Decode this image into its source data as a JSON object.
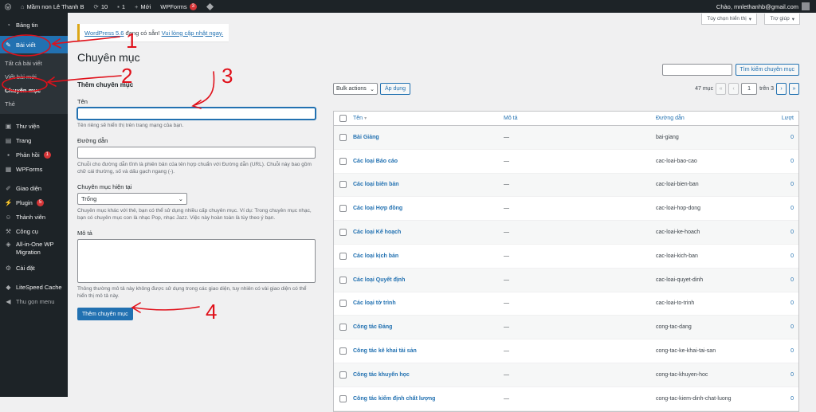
{
  "adminbar": {
    "site_name": "Mầm non Lê Thanh B",
    "updates_count": "10",
    "comments_count": "1",
    "new_label": "Mới",
    "wpforms_label": "WPForms",
    "wpforms_badge": "3",
    "greeting": "Chào, mnlethanhb@gmail.com"
  },
  "sidebar": {
    "items_top": [
      {
        "label": "Bảng tin",
        "icon": "dashboard-icon"
      }
    ],
    "active": {
      "label": "Bài viết",
      "icon": "pin-icon"
    },
    "submenu": [
      "Tất cả bài viết",
      "Viết bài mới",
      "Chuyên mục",
      "Thẻ"
    ],
    "items_bottom": [
      {
        "label": "Thư viện",
        "icon": "media-icon"
      },
      {
        "label": "Trang",
        "icon": "page-icon"
      },
      {
        "label": "Phản hồi",
        "icon": "comment-icon",
        "badge": "1"
      },
      {
        "label": "WPForms",
        "icon": "wpforms-icon"
      },
      {
        "label": "Giao diện",
        "icon": "appearance-icon"
      },
      {
        "label": "Plugin",
        "icon": "plugin-icon",
        "badge": "5"
      },
      {
        "label": "Thành viên",
        "icon": "users-icon"
      },
      {
        "label": "Công cụ",
        "icon": "tools-icon"
      },
      {
        "label": "All-in-One WP Migration",
        "icon": "migration-icon"
      },
      {
        "label": "Cài đặt",
        "icon": "settings-icon"
      },
      {
        "label": "LiteSpeed Cache",
        "icon": "litespeed-icon"
      },
      {
        "label": "Thu gọn menu",
        "icon": "collapse-icon"
      }
    ]
  },
  "screen": {
    "options": "Tùy chọn hiển thị",
    "help": "Trợ giúp"
  },
  "notice": {
    "pre": "WordPress 5.6",
    "mid": " đang có sẵn! ",
    "link": "Vui lòng cập nhật ngay."
  },
  "page_title": "Chuyên mục",
  "form": {
    "heading": "Thêm chuyên mục",
    "name_label": "Tên",
    "name_desc": "Tên riêng sẽ hiển thị trên trang mạng của bạn.",
    "slug_label": "Đường dẫn",
    "slug_desc": "Chuỗi cho đường dẫn tĩnh là phiên bản của tên hợp chuẩn với Đường dẫn (URL). Chuỗi này bao gồm chữ cái thường, số và dấu gạch ngang (-).",
    "parent_label": "Chuyên mục hiện tại",
    "parent_value": "Trống",
    "parent_desc": "Chuyên mục khác với thẻ, bạn có thể sử dụng nhiều cấp chuyên mục. Ví dụ: Trong chuyên mục nhạc, bạn có chuyên mục con là nhạc Pop, nhạc Jazz. Việc này hoàn toàn là tùy theo ý bạn.",
    "desc_label": "Mô tả",
    "desc_desc": "Thông thường mô tả này không được sử dụng trong các giao diện, tuy nhiên có vài giao diện có thể hiển thị mô tả này.",
    "submit": "Thêm chuyên mục"
  },
  "search_button": "Tìm kiếm chuyên mục",
  "bulk": {
    "select": "Bulk actions",
    "apply": "Áp dụng"
  },
  "pager": {
    "count": "47 mục",
    "first": "«",
    "prev": "‹",
    "current": "1",
    "of": "trên 3",
    "next": "›",
    "last": "»"
  },
  "table": {
    "columns": {
      "name": "Tên",
      "desc": "Mô tả",
      "slug": "Đường dẫn",
      "count": "Lượt"
    },
    "rows": [
      {
        "name": "Bài Giảng",
        "desc": "—",
        "slug": "bai-giang",
        "count": "0"
      },
      {
        "name": "Các loại Báo cáo",
        "desc": "—",
        "slug": "cac-loai-bao-cao",
        "count": "0"
      },
      {
        "name": "Các loại biên bản",
        "desc": "—",
        "slug": "cac-loai-bien-ban",
        "count": "0"
      },
      {
        "name": "Các loại Hợp đồng",
        "desc": "—",
        "slug": "cac-loai-hop-dong",
        "count": "0"
      },
      {
        "name": "Các loại Kế hoạch",
        "desc": "—",
        "slug": "cac-loai-ke-hoach",
        "count": "0"
      },
      {
        "name": "Các loại kịch bản",
        "desc": "—",
        "slug": "cac-loai-kich-ban",
        "count": "0"
      },
      {
        "name": "Các loại Quyết định",
        "desc": "—",
        "slug": "cac-loai-quyet-dinh",
        "count": "0"
      },
      {
        "name": "Các loại tờ trình",
        "desc": "—",
        "slug": "cac-loai-to-trinh",
        "count": "0"
      },
      {
        "name": "Công tác Đảng",
        "desc": "—",
        "slug": "cong-tac-dang",
        "count": "0"
      },
      {
        "name": "Công tác kê khai tài sản",
        "desc": "—",
        "slug": "cong-tac-ke-khai-tai-san",
        "count": "0"
      },
      {
        "name": "Công tác khuyến học",
        "desc": "—",
        "slug": "cong-tac-khuyen-hoc",
        "count": "0"
      },
      {
        "name": "Công tác kiểm định chất lượng",
        "desc": "—",
        "slug": "cong-tac-kiem-dinh-chat-luong",
        "count": "0"
      }
    ]
  },
  "annotations": [
    "1",
    "2",
    "3",
    "4"
  ],
  "colors": {
    "accent": "#2271b1",
    "menu_bg": "#1d2327",
    "annotation": "#e0101a"
  }
}
